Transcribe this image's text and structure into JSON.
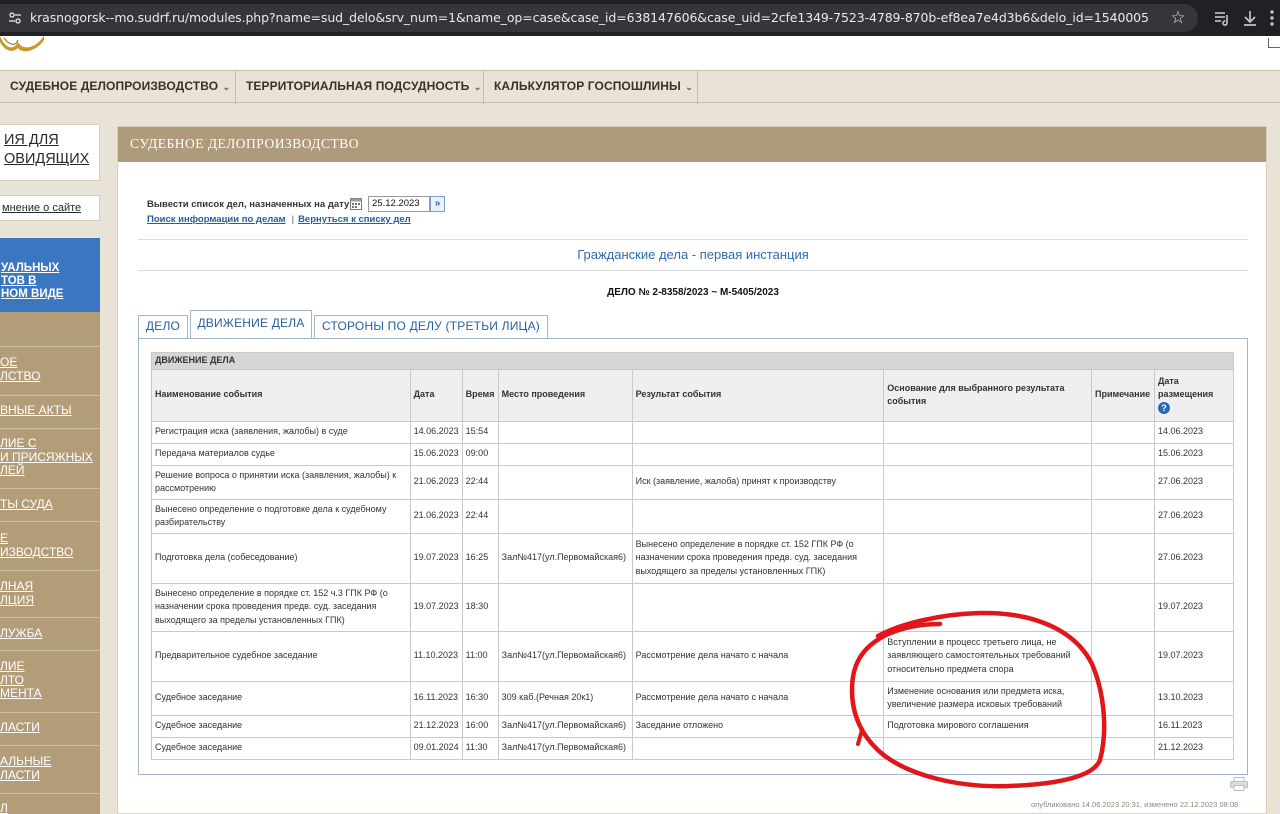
{
  "browser": {
    "url": "krasnogorsk--mo.sudrf.ru/modules.php?name=sud_delo&srv_num=1&name_op=case&case_id=638147606&case_uid=2cfe1349-7523-4789-870b-ef8ea7e4d3b6&delo_id=1540005"
  },
  "nav": {
    "items": [
      {
        "label": "СУДЕБНОЕ ДЕЛОПРОИЗВОДСТВО",
        "chevron": "⌄"
      },
      {
        "label": "ТЕРРИТОРИАЛЬНАЯ ПОДСУДНОСТЬ",
        "chevron": "⌄"
      },
      {
        "label": "КАЛЬКУЛЯТОР ГОСПОШЛИНЫ",
        "chevron": "⌄"
      }
    ]
  },
  "sidebar": {
    "box1": [
      "ИЯ ДЛЯ",
      "ОВИДЯЩИХ"
    ],
    "box2": "мнение о сайте",
    "blue": [
      "УАЛЬНЫХ",
      "ТОВ В",
      "НОМ ВИДЕ"
    ],
    "links": [
      [
        "ОЕ",
        "ЛСТВО"
      ],
      [
        "ВНЫЕ АКТЫ"
      ],
      [
        "ЛИЕ С",
        "И ПРИСЯЖНЫХ",
        "ЛЕЙ"
      ],
      [
        "ТЫ СУДА"
      ],
      [
        "Е",
        "ИЗВОДСТВО"
      ],
      [
        "ЛНАЯ",
        "ЛЦИЯ"
      ],
      [
        "ЛУЖБА"
      ],
      [
        "ЛИЕ",
        "ЛТО",
        "МЕНТА"
      ],
      [
        "ЛАСТИ"
      ],
      [
        "АЛЬНЫЕ",
        "ЛАСТИ"
      ],
      [
        "Л"
      ]
    ]
  },
  "panel": {
    "title": "СУДЕБНОЕ ДЕЛОПРОИЗВОДСТВО",
    "date_label": "Вывести список дел, назначенных на дату",
    "date_value": "25.12.2023",
    "go_glyph": "»",
    "link_search": "Поиск информации по делам",
    "link_sep": "|",
    "link_back": "Вернуться к списку дел",
    "case_category": "Гражданские дела - первая инстанция",
    "case_number": "ДЕЛО № 2-8358/2023 ~ М-5405/2023",
    "tabs": [
      "ДЕЛО",
      "ДВИЖЕНИЕ ДЕЛА",
      "СТОРОНЫ ПО ДЕЛУ (ТРЕТЬИ ЛИЦА)"
    ],
    "active_tab": 1,
    "published": "опубликовано 14.06.2023 20:31, изменено 22.12.2023 08:08"
  },
  "table": {
    "caption": "ДВИЖЕНИЕ ДЕЛА",
    "headers": [
      "Наименование события",
      "Дата",
      "Время",
      "Место проведения",
      "Результат события",
      "Основание для выбранного результата события",
      "Примечание",
      "Дата размещения"
    ],
    "rows": [
      [
        "Регистрация иска (заявления, жалобы) в суде",
        "14.06.2023",
        "15:54",
        "",
        "",
        "",
        "",
        "14.06.2023"
      ],
      [
        "Передача материалов судье",
        "15.06.2023",
        "09:00",
        "",
        "",
        "",
        "",
        "15.06.2023"
      ],
      [
        "Решение вопроса о принятии иска (заявления, жалобы) к рассмотрению",
        "21.06.2023",
        "22:44",
        "",
        "Иск (заявление, жалоба) принят к производству",
        "",
        "",
        "27.06.2023"
      ],
      [
        "Вынесено определение о подготовке дела к судебному разбирательству",
        "21.06.2023",
        "22:44",
        "",
        "",
        "",
        "",
        "27.06.2023"
      ],
      [
        "Подготовка дела (собеседование)",
        "19.07.2023",
        "16:25",
        "Зал№417(ул.Первомайская6)",
        "Вынесено определение в порядке ст. 152 ГПК РФ (о назначении срока проведения предв. суд. заседания выходящего за пределы установленных ГПК)",
        "",
        "",
        "27.06.2023"
      ],
      [
        "Вынесено определение в порядке ст. 152 ч.3 ГПК РФ (о назначении срока проведения предв. суд. заседания выходящего за пределы установленных ГПК)",
        "19.07.2023",
        "18:30",
        "",
        "",
        "",
        "",
        "19.07.2023"
      ],
      [
        "Предварительное судебное заседание",
        "11.10.2023",
        "11:00",
        "Зал№417(ул.Первомайская6)",
        "Рассмотрение дела начато с начала",
        "Вступлении в процесс третьего лица, не заявляющего самостоятельных требований относительно предмета спора",
        "",
        "19.07.2023"
      ],
      [
        "Судебное заседание",
        "16.11.2023",
        "16:30",
        "309 каб.(Речная 20к1)",
        "Рассмотрение дела начато с начала",
        "Изменение основания или предмета иска, увеличение размера исковых требований",
        "",
        "13.10.2023"
      ],
      [
        "Судебное заседание",
        "21.12.2023",
        "16:00",
        "Зал№417(ул.Первомайская6)",
        "Заседание отложено",
        "Подготовка мирового соглашения",
        "",
        "16.11.2023"
      ],
      [
        "Судебное заседание",
        "09.01.2024",
        "11:30",
        "Зал№417(ул.Первомайская6)",
        "",
        "",
        "",
        "21.12.2023"
      ]
    ]
  },
  "colors": {
    "panel_header": "#ad9b7c",
    "sidebar": "#b39d79",
    "sidebar_active": "#3b77c1",
    "link": "#1f5fa6",
    "annotation": "#e0161b"
  }
}
